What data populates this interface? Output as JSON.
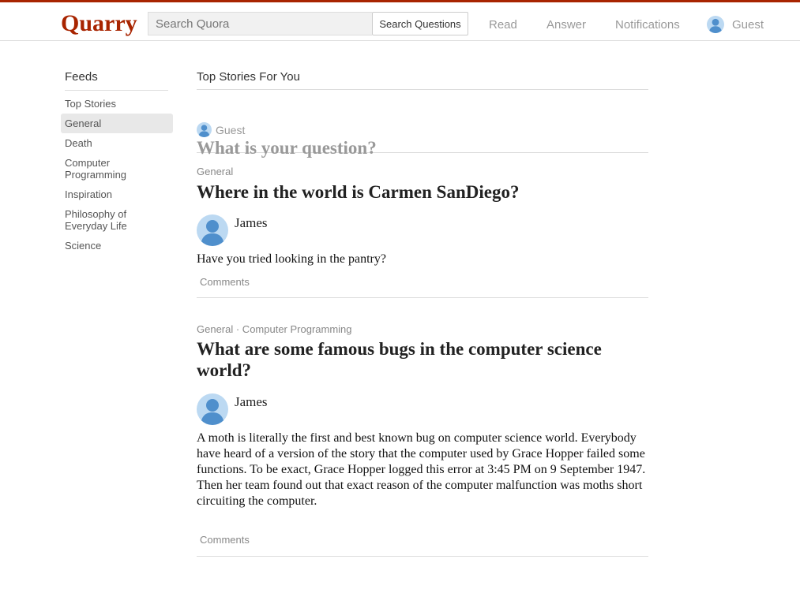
{
  "header": {
    "logo": "Quarry",
    "search": {
      "placeholder": "Search Quora",
      "value": ""
    },
    "search_button_label": "Search Questions",
    "nav": {
      "read": "Read",
      "answer": "Answer",
      "notifications": "Notifications"
    },
    "user_name": "Guest"
  },
  "sidebar": {
    "title": "Feeds",
    "items": [
      {
        "label": "Top Stories"
      },
      {
        "label": "General"
      },
      {
        "label": "Death"
      },
      {
        "label": "Computer Programming"
      },
      {
        "label": "Inspiration"
      },
      {
        "label": "Philosophy of Everyday Life"
      },
      {
        "label": "Science"
      }
    ],
    "active_item": "General"
  },
  "main": {
    "title": "Top Stories For You",
    "ask": {
      "user": "Guest",
      "prompt": "What is your question?"
    },
    "stories": [
      {
        "topics": "General",
        "question": "Where in the world is Carmen SanDiego?",
        "author": "James",
        "answer": "Have you tried looking in the pantry?",
        "comments_label": "Comments"
      },
      {
        "topics": "General · Computer Programming",
        "question": "What are some famous bugs in the computer science world?",
        "author": "James",
        "answer": "A moth is literally the first and best known bug on computer science world. Everybody have heard of a version of the story that the computer used by Grace Hopper failed some functions. To be exact, Grace Hopper logged this error at 3:45 PM on 9 September 1947.\nThen her team found out that exact reason of the computer malfunction was moths short circuiting the computer.",
        "comments_label": "Comments"
      }
    ]
  },
  "colors": {
    "brand": "#a82400",
    "avatar": "#bcd9f2",
    "avatar_figure": "#4f8fcc"
  },
  "icons": {
    "avatar": "user-avatar-icon"
  }
}
